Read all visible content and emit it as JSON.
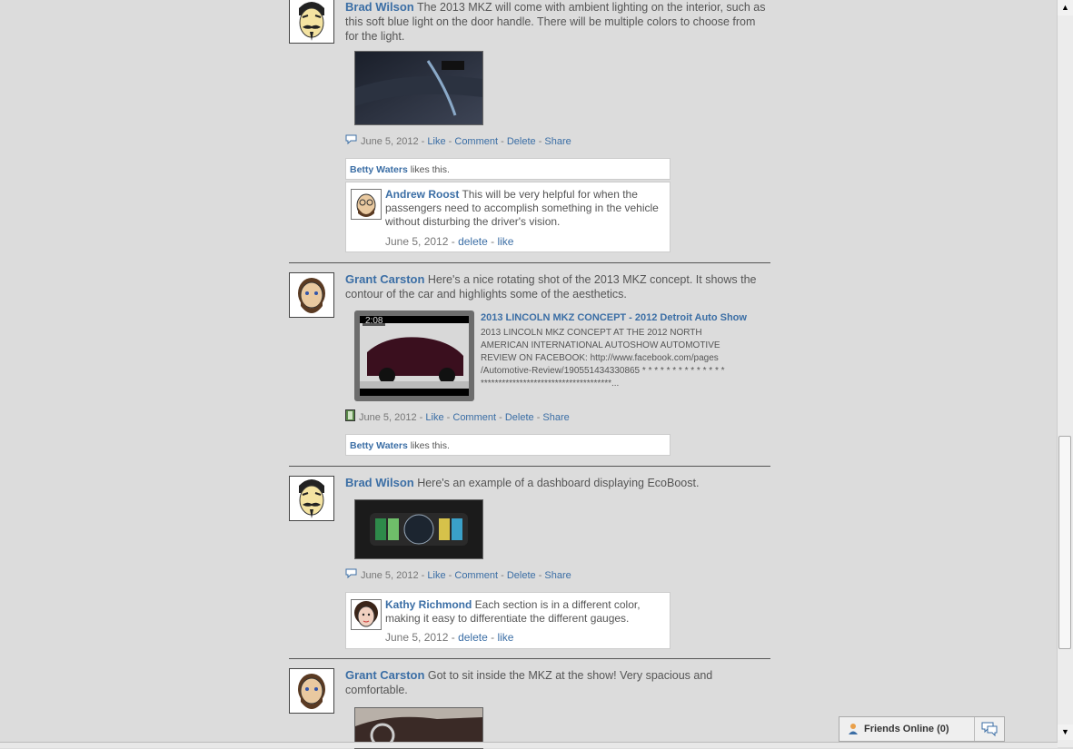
{
  "posts": [
    {
      "author": "Brad Wilson",
      "text": " The 2013 MKZ will come with ambient lighting on the interior, such as this soft blue light on the door handle. There will be multiple colors to choose from for the light.",
      "date": "June 5, 2012",
      "actions": [
        "Like",
        "Comment",
        "Delete",
        "Share"
      ],
      "likes": {
        "name": "Betty Waters",
        "suffix": " likes this."
      },
      "comment": {
        "author": "Andrew Roost",
        "text": " This will be very helpful for when the passengers need to accomplish something in the vehicle without disturbing the driver's vision.",
        "date": "June 5, 2012",
        "delete": "delete",
        "like": "like"
      }
    },
    {
      "author": "Grant Carston",
      "text": " Here's a nice rotating shot of the 2013 MKZ concept. It shows the contour of the car and highlights some of the aesthetics.",
      "video": {
        "duration": "2:08",
        "title": "2013 LINCOLN MKZ CONCEPT - 2012 Detroit Auto Show",
        "description": "2013 LINCOLN MKZ CONCEPT AT THE 2012 NORTH AMERICAN INTERNATIONAL AUTOSHOW AUTOMOTIVE REVIEW ON FACEBOOK: http://www.facebook.com/pages /Automotive-Review/190551434330865 * * * * * * * * * * * * * * *************************************..."
      },
      "date": "June 5, 2012",
      "actions": [
        "Like",
        "Comment",
        "Delete",
        "Share"
      ],
      "likes": {
        "name": "Betty Waters",
        "suffix": " likes this."
      }
    },
    {
      "author": "Brad Wilson",
      "text": " Here's an example of a dashboard displaying EcoBoost.",
      "date": "June 5, 2012",
      "actions": [
        "Like",
        "Comment",
        "Delete",
        "Share"
      ],
      "comment": {
        "author": "Kathy Richmond",
        "text": " Each section is in a different color, making it easy to differentiate the different gauges.",
        "date": "June 5, 2012",
        "delete": "delete",
        "like": "like"
      }
    },
    {
      "author": "Grant Carston",
      "text": " Got to sit inside the MKZ at the show! Very spacious and comfortable."
    }
  ],
  "friends_bar": {
    "label": "Friends Online (0)"
  },
  "icons": {
    "comment": "speech-bubble-icon",
    "video": "film-strip-icon",
    "friends": "person-icon",
    "chat": "chat-bubbles-icon"
  },
  "colors": {
    "link": "#3b6ea5",
    "background": "#dcdcdc"
  }
}
